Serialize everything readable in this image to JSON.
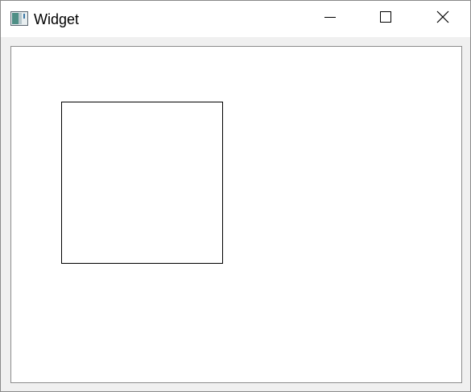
{
  "window": {
    "title": "Widget",
    "app_icon": "qt-widget-app-icon",
    "controls": {
      "minimize_icon": "minimize-icon",
      "maximize_icon": "maximize-icon",
      "close_icon": "close-icon"
    }
  },
  "canvas": {
    "background": "#ffffff",
    "shape": {
      "kind": "rectangle",
      "stroke_color": "#000000",
      "fill": "none"
    }
  }
}
